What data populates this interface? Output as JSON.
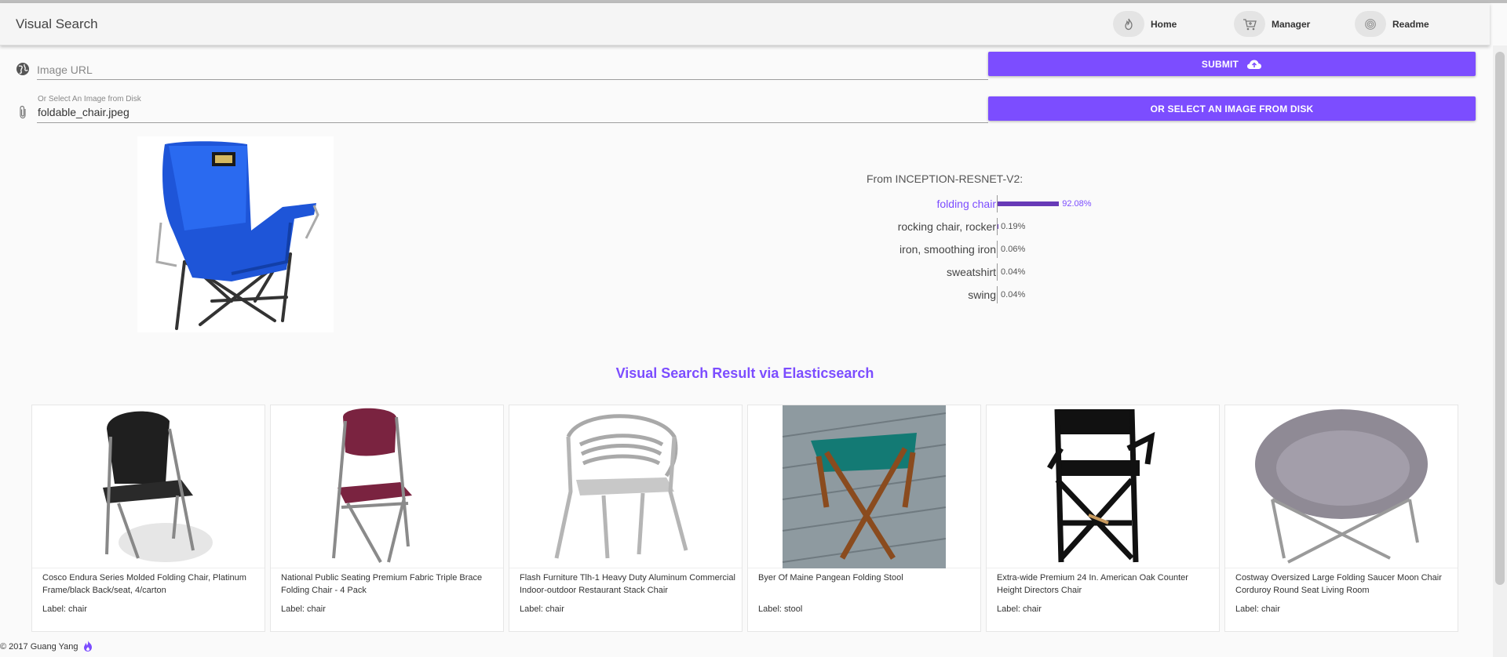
{
  "app": {
    "title": "Visual Search"
  },
  "nav": [
    {
      "label": "Home",
      "icon": "flame-icon"
    },
    {
      "label": "Manager",
      "icon": "cart-icon"
    },
    {
      "label": "Readme",
      "icon": "fingerprint-icon"
    }
  ],
  "form": {
    "url_placeholder": "Image URL",
    "url_value": "",
    "disk_caption": "Or Select An Image from Disk",
    "disk_value": "foldable_chair.jpeg",
    "submit_label": "SUBMIT",
    "select_label": "OR SELECT AN IMAGE FROM DISK"
  },
  "colors": {
    "accent": "#7c4dff",
    "bar": "#673ab7"
  },
  "prediction": {
    "model_title": "From INCEPTION-RESNET-V2:",
    "items": [
      {
        "label": "folding chair",
        "value": "92.08%",
        "percent": 92.08
      },
      {
        "label": "rocking chair, rocker",
        "value": "0.19%",
        "percent": 0.19
      },
      {
        "label": "iron, smoothing iron",
        "value": "0.06%",
        "percent": 0.06
      },
      {
        "label": "sweatshirt",
        "value": "0.04%",
        "percent": 0.04
      },
      {
        "label": "swing",
        "value": "0.04%",
        "percent": 0.04
      }
    ]
  },
  "results": {
    "heading": "Visual Search Result via Elasticsearch",
    "items": [
      {
        "title": "Cosco Endura Series Molded Folding Chair, Platinum Frame/black Back/seat, 4/carton",
        "label": "Label: chair"
      },
      {
        "title": "National Public Seating Premium Fabric Triple Brace Folding Chair - 4 Pack",
        "label": "Label: chair"
      },
      {
        "title": "Flash Furniture Tlh-1 Heavy Duty Aluminum Commercial Indoor-outdoor Restaurant Stack Chair",
        "label": "Label: chair"
      },
      {
        "title": "Byer Of Maine Pangean Folding Stool",
        "label": "Label: stool"
      },
      {
        "title": "Extra-wide Premium 24 In. American Oak Counter Height Directors Chair",
        "label": "Label: chair"
      },
      {
        "title": "Costway Oversized Large Folding Saucer Moon Chair Corduroy Round Seat Living Room",
        "label": "Label: chair"
      }
    ]
  },
  "footer": {
    "text": "© 2017 Guang Yang"
  }
}
